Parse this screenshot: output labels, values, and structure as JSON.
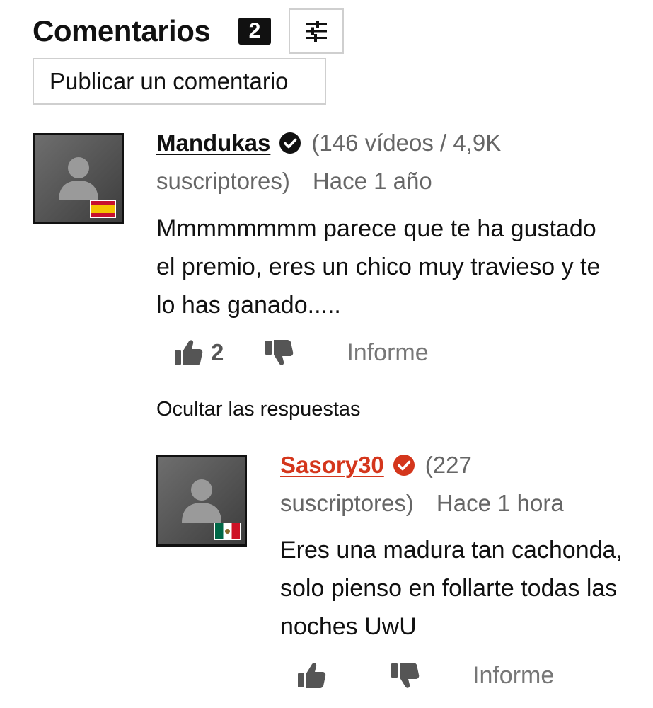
{
  "header": {
    "title": "Comentarios",
    "count": "2",
    "filter_icon": "sliders-icon",
    "post_button_label": "Publicar un comentario"
  },
  "comments": [
    {
      "username": "Mandukas",
      "username_color": "#111111",
      "verified_color": "#111111",
      "stats": "(146 vídeos / 4,9K suscriptores)",
      "time_ago": "Hace 1 año",
      "text": "Mmmmmmmm parece que te ha gustado el premio, eres un chico muy travieso y te lo has ganado.....",
      "flag": "Spain",
      "likes": "2",
      "report_label": "Informe"
    }
  ],
  "hide_replies_label": "Ocultar las respuestas",
  "replies": [
    {
      "username": "Sasory30",
      "username_color": "#d4361c",
      "verified_color": "#d4361c",
      "stats": "(227 suscriptores)",
      "time_ago": "Hace 1 hora",
      "text": "Eres una madura tan cachonda, solo pienso en follarte todas las noches UwU",
      "flag": "Mexico",
      "likes": "",
      "report_label": "Informe"
    }
  ],
  "icons": {
    "like": "thumbs-up-icon",
    "dislike": "thumbs-down-icon",
    "verified": "verified-check-icon"
  }
}
